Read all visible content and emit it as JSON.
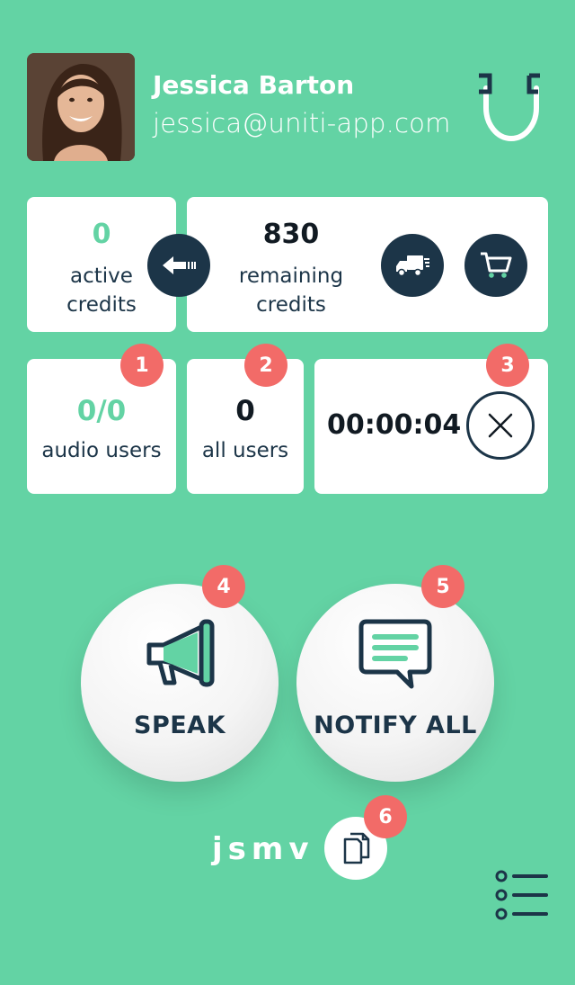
{
  "user": {
    "name": "Jessica Barton",
    "email": "jessica@uniti-app.com"
  },
  "credits": {
    "active_value": "0",
    "active_label_1": "active",
    "active_label_2": "credits",
    "remaining_value": "830",
    "remaining_label_1": "remaining",
    "remaining_label_2": "credits"
  },
  "stats": {
    "audio_users_value": "0/0",
    "audio_users_label": "audio users",
    "all_users_value": "0",
    "all_users_label": "all users",
    "timer": "00:00:04"
  },
  "badges": [
    "1",
    "2",
    "3",
    "4",
    "5",
    "6"
  ],
  "actions": {
    "speak_label": "SPEAK",
    "notify_label": "NOTIFY ALL"
  },
  "session": {
    "code": "jsmv"
  },
  "colors": {
    "background": "#63d3a4",
    "dark": "#1c3548",
    "badge": "#f26b68",
    "card": "#ffffff"
  }
}
